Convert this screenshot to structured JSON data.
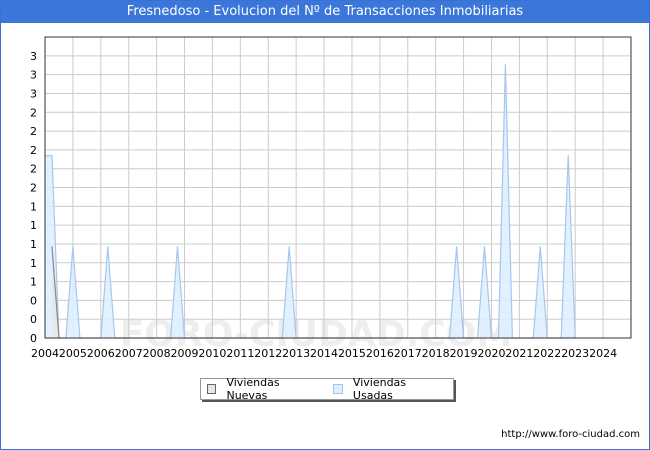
{
  "header": {
    "title": "Fresnedoso - Evolucion del Nº de Transacciones Inmobiliarias"
  },
  "footer": {
    "url": "http://www.foro-ciudad.com"
  },
  "watermark": "FORO-CIUDAD.COM",
  "colors": {
    "title_bg": "#3a77d9",
    "nuevas_fill": "#e6e6e6",
    "nuevas_line": "#888888",
    "usadas_fill": "#ddeeff",
    "usadas_line": "#a7c6ec",
    "grid": "#cccccc"
  },
  "chart_data": {
    "type": "area",
    "title": "Fresnedoso - Evolucion del Nº de Transacciones Inmobiliarias",
    "xlabel": "",
    "ylabel": "",
    "x_ticks": [
      "2004",
      "2005",
      "2006",
      "2007",
      "2008",
      "2009",
      "2010",
      "2011",
      "2012",
      "2013",
      "2014",
      "2015",
      "2016",
      "2017",
      "2018",
      "2019",
      "2020",
      "2021",
      "2022",
      "2023",
      "2024"
    ],
    "y_ticks": [
      "0",
      "0",
      "0",
      "1",
      "1",
      "1",
      "1",
      "1",
      "2",
      "2",
      "2",
      "2",
      "2",
      "3",
      "3",
      "3"
    ],
    "ylim": [
      0,
      3.3
    ],
    "xlim": [
      2004,
      2025
    ],
    "grid": true,
    "legend_position": "bottom",
    "series": [
      {
        "name": "Viviendas Nuevas",
        "points": [
          [
            2004.25,
            1
          ],
          [
            2004.5,
            0
          ]
        ]
      },
      {
        "name": "Viviendas Usadas",
        "points": [
          [
            2004.0,
            2
          ],
          [
            2004.25,
            2
          ],
          [
            2004.5,
            0
          ],
          [
            2004.75,
            0
          ],
          [
            2005.0,
            1
          ],
          [
            2005.25,
            0
          ],
          [
            2006.0,
            0
          ],
          [
            2006.25,
            1
          ],
          [
            2006.5,
            0
          ],
          [
            2008.5,
            0
          ],
          [
            2008.75,
            1
          ],
          [
            2009.0,
            0
          ],
          [
            2012.5,
            0
          ],
          [
            2012.75,
            1
          ],
          [
            2013.0,
            0
          ],
          [
            2018.5,
            0
          ],
          [
            2018.75,
            1
          ],
          [
            2019.0,
            0
          ],
          [
            2019.5,
            0
          ],
          [
            2019.75,
            1
          ],
          [
            2020.0,
            0
          ],
          [
            2020.25,
            0
          ],
          [
            2020.5,
            3
          ],
          [
            2020.75,
            0
          ],
          [
            2021.5,
            0
          ],
          [
            2021.75,
            1
          ],
          [
            2022.0,
            0
          ],
          [
            2022.5,
            0
          ],
          [
            2022.75,
            2
          ],
          [
            2023.0,
            0
          ]
        ]
      }
    ]
  }
}
